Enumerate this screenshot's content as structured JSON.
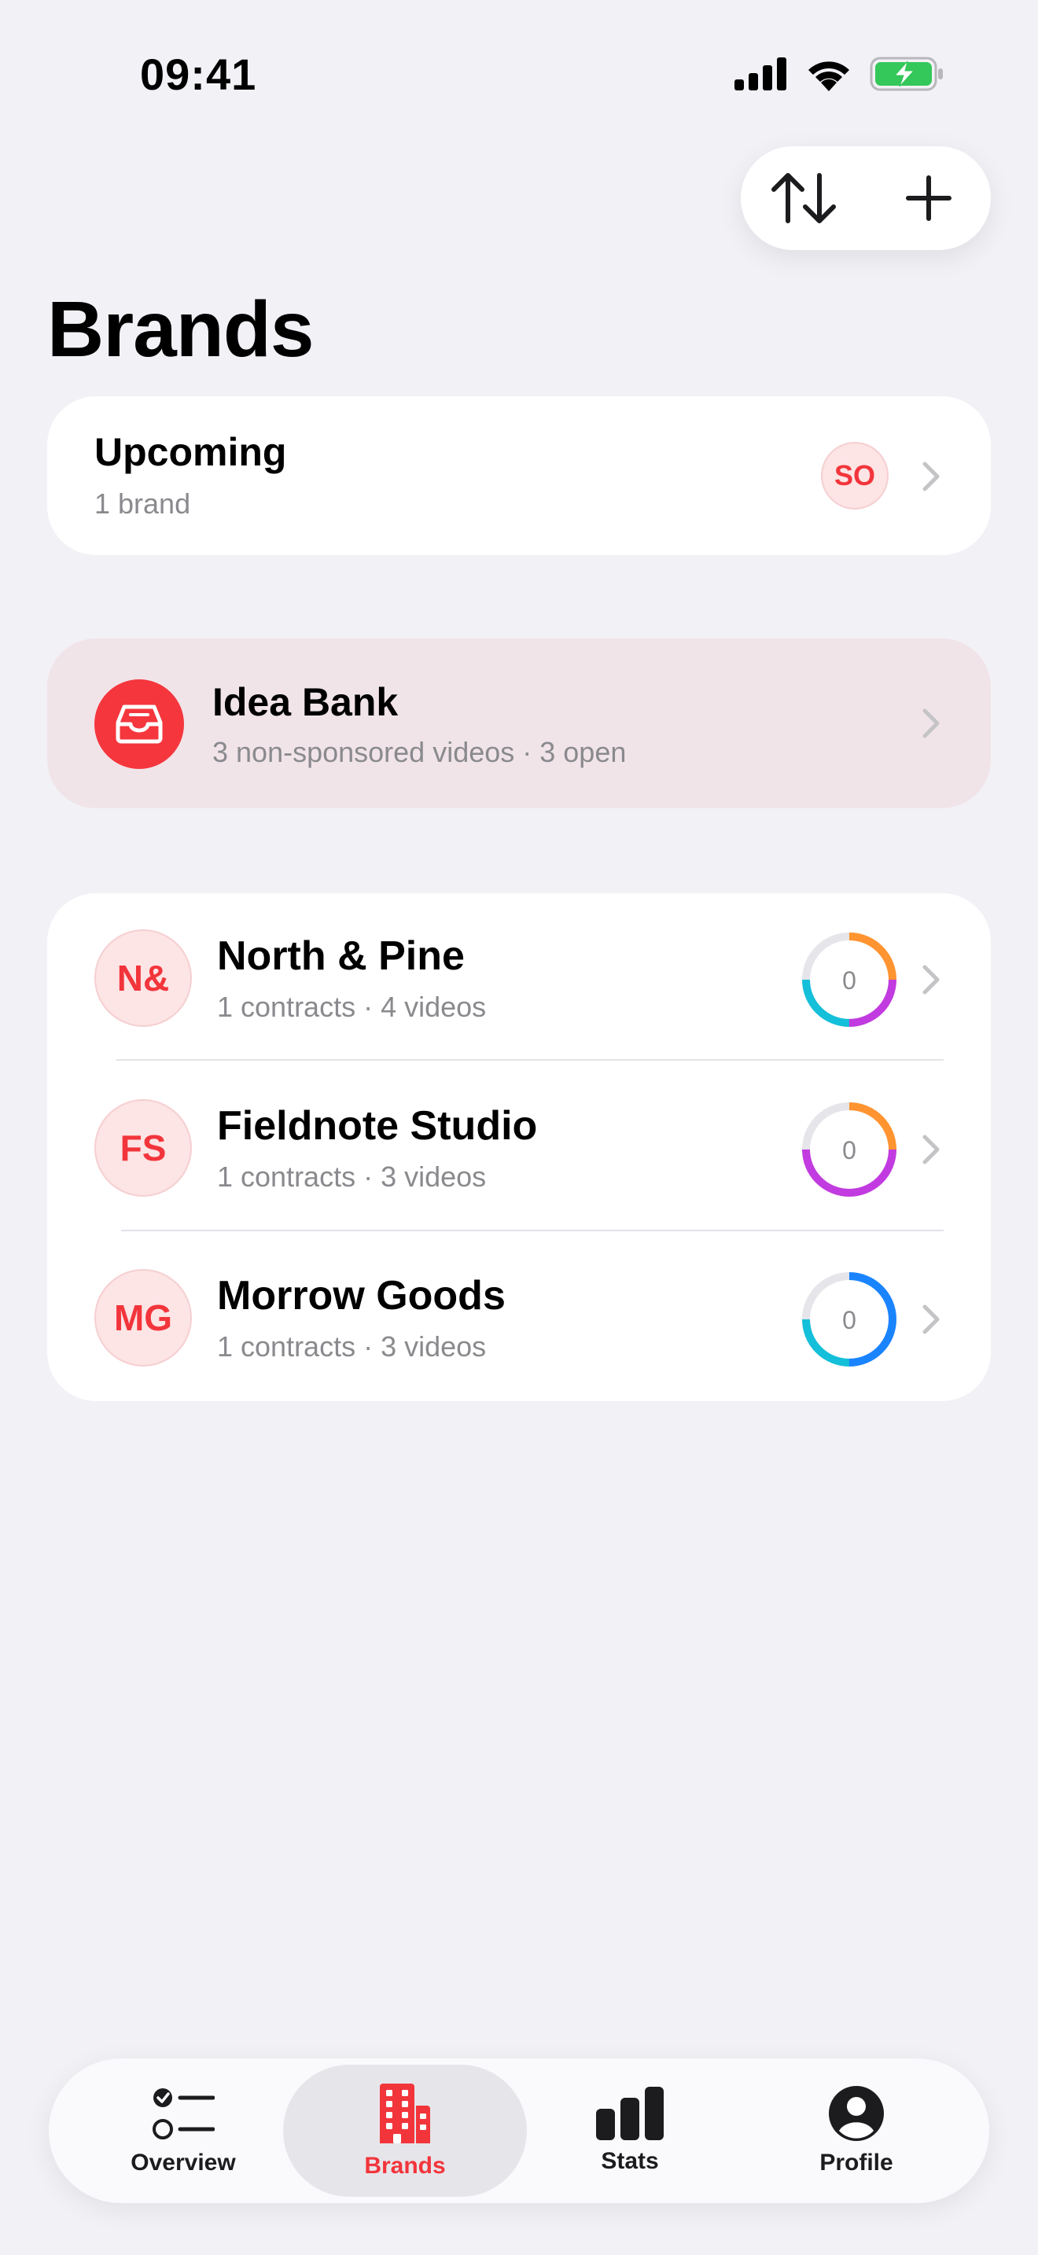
{
  "status_bar": {
    "time": "09:41"
  },
  "header": {
    "title": "Brands"
  },
  "toolbar": {
    "sort_icon": "sort-arrows-icon",
    "add_icon": "plus-icon"
  },
  "upcoming": {
    "title": "Upcoming",
    "subtitle": "1 brand",
    "badge": "SO"
  },
  "idea_bank": {
    "title": "Idea Bank",
    "subtitle": "3 non-sponsored videos · 3 open",
    "icon": "tray-icon"
  },
  "brands": [
    {
      "initials": "N&",
      "name": "North & Pine",
      "subtitle": "1 contracts · 4 videos",
      "count": "0"
    },
    {
      "initials": "FS",
      "name": "Fieldnote Studio",
      "subtitle": "1 contracts · 3 videos",
      "count": "0"
    },
    {
      "initials": "MG",
      "name": "Morrow Goods",
      "subtitle": "1 contracts · 3 videos",
      "count": "0"
    }
  ],
  "tabs": [
    {
      "label": "Overview",
      "icon": "checklist-icon",
      "active": false
    },
    {
      "label": "Brands",
      "icon": "building-icon",
      "active": true
    },
    {
      "label": "Stats",
      "icon": "bar-chart-icon",
      "active": false
    },
    {
      "label": "Profile",
      "icon": "person-circle-icon",
      "active": false
    }
  ],
  "colors": {
    "accent": "#f2353b",
    "orange": "#ff9430",
    "purple": "#c23be0",
    "cyan": "#14bfd9",
    "blue": "#1a84ff"
  }
}
